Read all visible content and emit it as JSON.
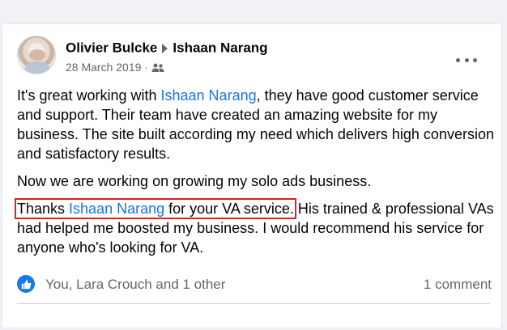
{
  "post": {
    "author": "Olivier Bulcke",
    "target": "Ishaan Narang",
    "date": "28 March 2019",
    "date_separator": "·",
    "audience_icon": "group-icon",
    "more_icon": "more-options-icon",
    "paragraphs": {
      "p1_before": "It's great working with ",
      "p1_link": "Ishaan Narang",
      "p1_after": ", they have good customer service and support. Their team have created an amazing website for my business. The site built according my need which delivers high conversion and satisfactory results.",
      "p2": "Now we are working on growing my solo ads business.",
      "p3_highlight_before": "Thanks ",
      "p3_link": "Ishaan Narang",
      "p3_highlight_after": " for your VA service.",
      "p3_after": " His trained & professional VAs had helped me boosted my business. I would recommend his service for anyone who's looking for VA."
    }
  },
  "footer": {
    "reaction_icon": "like-icon",
    "reactions_text": "You, Lara Crouch and 1 other",
    "comments_text": "1 comment"
  },
  "colors": {
    "link": "#1b74e4",
    "highlight_border": "#e0201b",
    "like_blue": "#1877f2",
    "muted_text": "#65676b"
  }
}
